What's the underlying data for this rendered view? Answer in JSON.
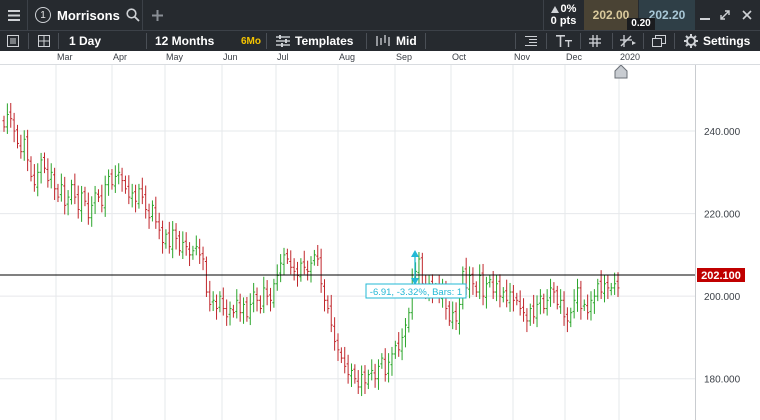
{
  "header": {
    "instrument_number": "1",
    "instrument_name": "Morrisons",
    "change_pct": "0%",
    "change_pts": "0 pts",
    "bid": "202.00",
    "ask": "202.20",
    "spread": "0.20"
  },
  "toolbar": {
    "interval": "1 Day",
    "range": "12 Months",
    "range_badge": "6Mo",
    "templates_label": "Templates",
    "price_type": "Mid",
    "settings_label": "Settings"
  },
  "colors": {
    "up": "#2aa52a",
    "down": "#c0262b",
    "price_tag": "#c00000",
    "measure": "#23b8d6",
    "topbar": "#262a2f"
  },
  "chart_data": {
    "type": "ohlc",
    "months": [
      "Mar",
      "Apr",
      "May",
      "Jun",
      "Jul",
      "Aug",
      "Sep",
      "Oct",
      "Nov",
      "Dec",
      "2020"
    ],
    "y_ticks": [
      "240.000",
      "220.000",
      "200.000",
      "180.000"
    ],
    "ylim": [
      170,
      256
    ],
    "last_price": "202.100",
    "measure_label": "-6.91, -3.32%, Bars: 1",
    "closes": [
      241,
      244,
      243,
      240,
      237,
      235,
      238,
      233,
      229,
      227,
      230,
      233,
      231,
      228,
      230,
      226,
      224,
      227,
      222,
      224,
      227,
      224,
      221,
      225,
      223,
      219,
      222,
      225,
      224,
      222,
      227,
      229,
      227,
      229,
      230,
      228,
      226,
      224,
      225,
      223,
      226,
      224,
      221,
      219,
      222,
      218,
      216,
      213,
      215,
      212,
      216,
      214,
      211,
      213,
      212,
      210,
      211,
      212,
      210,
      209,
      201,
      198,
      199,
      197,
      200,
      197,
      195,
      197,
      196,
      199,
      196,
      198,
      195,
      198,
      201,
      199,
      197,
      202,
      200,
      199,
      203,
      205,
      208,
      210,
      209,
      207,
      206,
      205,
      208,
      207,
      206,
      208,
      210,
      209,
      203,
      199,
      197,
      193,
      189,
      187,
      185,
      183,
      181,
      182,
      180,
      178,
      181,
      179,
      181,
      182,
      180,
      183,
      185,
      181,
      184,
      186,
      188,
      187,
      190,
      193,
      196,
      204,
      206,
      209,
      203,
      201,
      203,
      201,
      202,
      200,
      202,
      197,
      194,
      196,
      194,
      198,
      206,
      202,
      205,
      203,
      201,
      205,
      200,
      203,
      204,
      201,
      203,
      200,
      201,
      199,
      201,
      199,
      199,
      197,
      196,
      194,
      197,
      195,
      198,
      200,
      197,
      199,
      202,
      201,
      198,
      199,
      195,
      194,
      196,
      199,
      202,
      197,
      198,
      196,
      199,
      200,
      203,
      201,
      203,
      202,
      202,
      203,
      202
    ]
  }
}
